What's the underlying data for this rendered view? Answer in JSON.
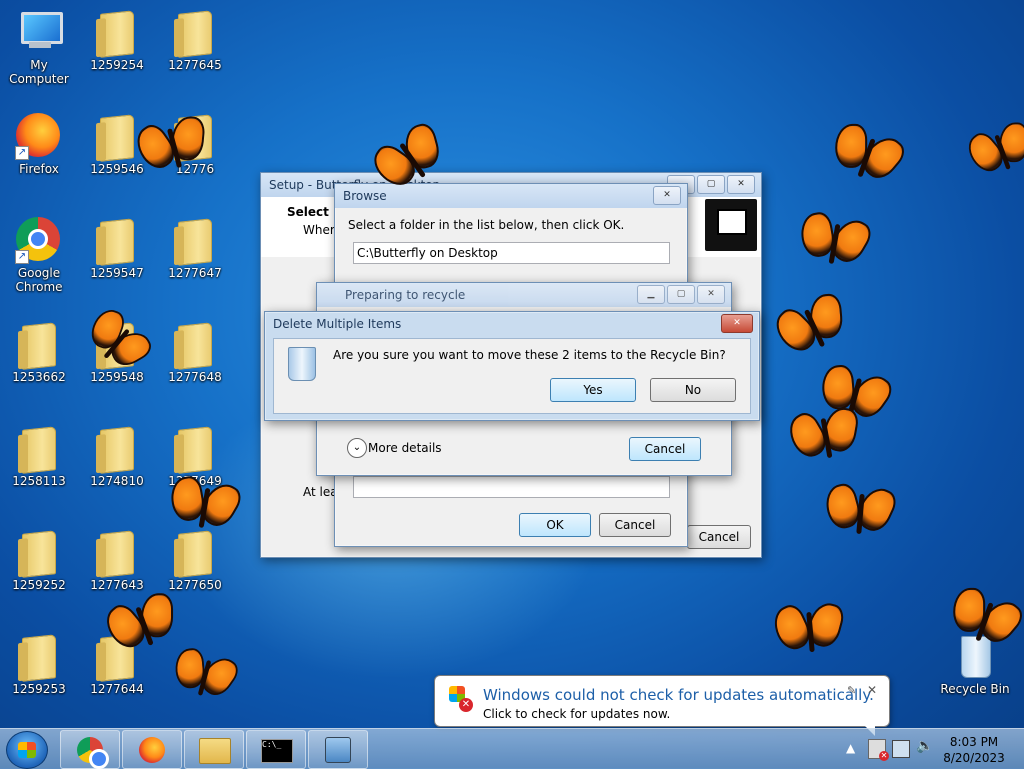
{
  "desktop": {
    "icons": [
      {
        "label": "My Computer"
      },
      {
        "label": "1259254"
      },
      {
        "label": "1277645"
      },
      {
        "label": "Firefox"
      },
      {
        "label": "1259546"
      },
      {
        "label": "12776"
      },
      {
        "label": "Google Chrome"
      },
      {
        "label": "1259547"
      },
      {
        "label": "1277647"
      },
      {
        "label": "1253662"
      },
      {
        "label": "1259548"
      },
      {
        "label": "1277648"
      },
      {
        "label": "1258113"
      },
      {
        "label": "1274810"
      },
      {
        "label": "1277649"
      },
      {
        "label": "1259252"
      },
      {
        "label": "1277643"
      },
      {
        "label": "1277650"
      },
      {
        "label": "1259253"
      },
      {
        "label": "1277644"
      },
      {
        "label": "Recycle Bin"
      }
    ]
  },
  "setup_window": {
    "title": "Setup - Butterfly on Desktop",
    "heading": "Select D",
    "subtext": "Where",
    "bottom_text": "At leas",
    "cancel_label": "Cancel"
  },
  "browse_window": {
    "title": "Browse",
    "instruction": "Select a folder in the list below, then click OK.",
    "path_value": "C:\\Butterfly on Desktop",
    "ok_label": "OK",
    "cancel_label": "Cancel"
  },
  "recycle_window": {
    "title": "Preparing to recycle",
    "more_details_label": "More details",
    "cancel_label": "Cancel"
  },
  "delete_dialog": {
    "title": "Delete Multiple Items",
    "message": "Are you sure you want to move these 2 items to the Recycle Bin?",
    "yes_label": "Yes",
    "no_label": "No"
  },
  "balloon": {
    "title": "Windows could not check for updates automatically.",
    "body": "Click to check for updates now."
  },
  "taskbar": {
    "time": "8:03 PM",
    "date": "8/20/2023"
  },
  "colors": {
    "desktop_blue": "#1671c8",
    "dialog_blue_text": "#1e395b",
    "balloon_title": "#1d5fa8"
  }
}
